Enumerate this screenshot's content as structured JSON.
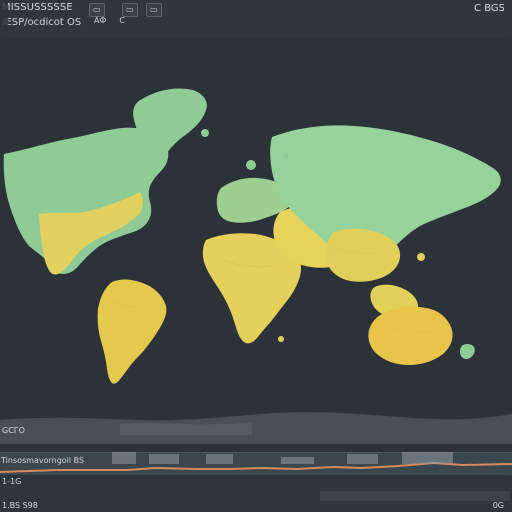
{
  "header": {
    "title": "MISSUSSSSSE",
    "subtitle": "ÆSP/ocdicot OS",
    "tab_one": "АФ",
    "tab_two": "С",
    "tab_three": "",
    "corner": "C BGS"
  },
  "bottom": {
    "scale_label": "GСГO",
    "timeline_label": "Tinsosmavorngoil BS",
    "footer_label": "1-1G",
    "footer_bottom_left": "1.BS S98",
    "footer_bottom_right": "0G"
  },
  "colors": {
    "background": "#2b3339",
    "panel": "#313a40",
    "ocean": "#2b3339",
    "green": "#8fcb97",
    "yellow": "#e6d35c"
  }
}
